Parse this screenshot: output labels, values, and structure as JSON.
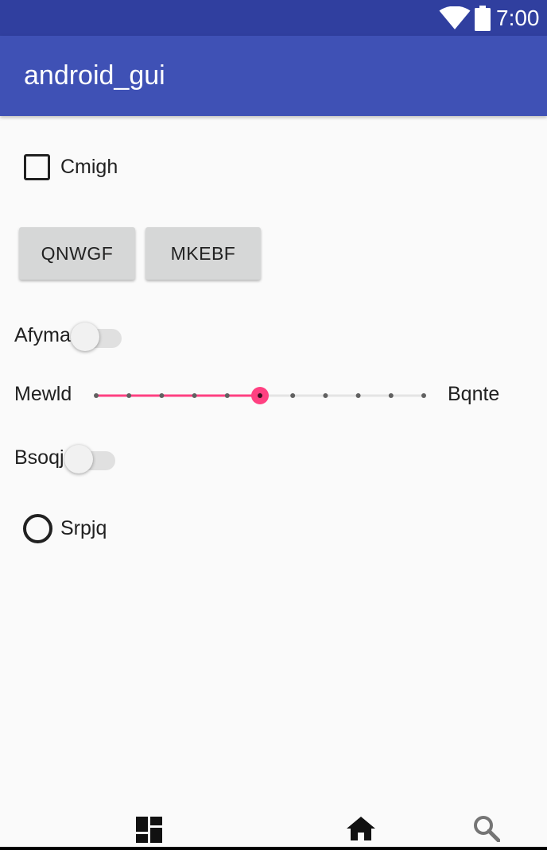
{
  "status_bar": {
    "time": "7:00",
    "icons": [
      "wifi-icon",
      "battery-icon"
    ]
  },
  "app_bar": {
    "title": "android_gui"
  },
  "checkbox": {
    "label": "Cmigh",
    "checked": false
  },
  "buttons": [
    {
      "label": "QNWGF"
    },
    {
      "label": "MKEBF"
    }
  ],
  "switches": [
    {
      "label": "Afyma",
      "on": false
    },
    {
      "label": "Bsoqj",
      "on": false
    }
  ],
  "seekbar": {
    "min_label": "Mewld",
    "max_label": "Bqnte",
    "value": 5,
    "max": 10,
    "accent_color": "#ff4081"
  },
  "radio": {
    "label": "Srpjq",
    "selected": false
  },
  "bottom_nav": {
    "icons": [
      "dashboard-icon",
      "home-icon",
      "search-icon"
    ]
  },
  "colors": {
    "status_bar": "#303f9f",
    "app_bar": "#3f51b5",
    "accent": "#ff4081",
    "background": "#fafafa"
  }
}
